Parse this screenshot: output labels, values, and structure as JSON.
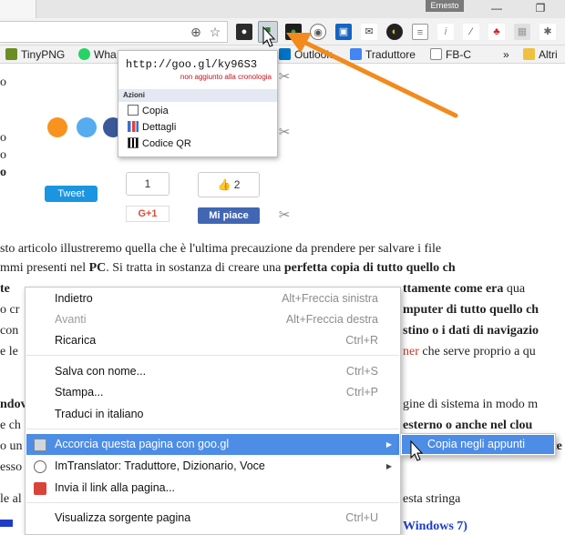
{
  "window": {
    "user_badge": "Ernesto",
    "minimize_glyph": "—",
    "restore_glyph": "❐"
  },
  "toolbar": {
    "zoom_icon": "⊕",
    "star_icon": "☆",
    "extensions": [
      "ghostery-icon",
      "googl-shortener-icon",
      "green-ext-icon",
      "imtranslator-icon",
      "screenshot-icon",
      "mail-icon",
      "colorpicker-icon",
      "notes-icon",
      "info-icon",
      "eyedropper-icon",
      "user-block-icon",
      "image-icon",
      "puzzle-icon"
    ]
  },
  "bookmarks": {
    "items": [
      {
        "label": "TinyPNG"
      },
      {
        "label": "Wha"
      },
      {
        "label": "Outlook"
      },
      {
        "label": "Traduttore"
      },
      {
        "label": "FB-C"
      },
      {
        "label": "Altri"
      }
    ],
    "overflow": "»"
  },
  "googl_popup": {
    "url": "http://goo.gl/ky96S3",
    "note": "non aggiunto alla cronologia",
    "section": "Azioni",
    "actions": [
      {
        "label": "Copia"
      },
      {
        "label": "Dettagli"
      },
      {
        "label": "Codice QR"
      }
    ]
  },
  "social": {
    "tweet_label": "Tweet",
    "gplus_count": "1",
    "gplus_label": "G+1",
    "like_count": "2",
    "like_label": "Mi piace"
  },
  "article": {
    "line1_a": "sto articolo illustreremo quella che è l'ultima precauzione da prendere per salvare i file",
    "line2_a": "mmi presenti nel ",
    "line2_b": "PC",
    "line2_c": ". Si tratta in sostanza di creare una ",
    "line2_d": "perfetta copia di tutto quello ch",
    "line3_a": "te",
    "line3_b": "ttamente come era",
    "line3_c": " qua",
    "line4_a": "o cr",
    "line4_b": "mputer di tutto quello ch",
    "line5_a": "con",
    "line5_b": "stino o i dati di navigazio",
    "line6_a": "e le",
    "line6_b": "ner",
    "line6_c": " che serve proprio a qu",
    "line7_a": "ndov",
    "line7_b": "gine di sistema in modo m",
    "line8_a": "e ch",
    "line8_b": "esterno o anche nel clou",
    "line9_a": "o un",
    "line9_b": "te",
    "line10_a": "esso",
    "line11_a": "le al",
    "line11_b": "esta stringa",
    "line12_b": "Windows 7)"
  },
  "context_menu": {
    "items": [
      {
        "label": "Indietro",
        "shortcut": "Alt+Freccia sinistra"
      },
      {
        "label": "Avanti",
        "shortcut": "Alt+Freccia destra"
      },
      {
        "label": "Ricarica",
        "shortcut": "Ctrl+R"
      },
      {
        "label": "Salva con nome...",
        "shortcut": "Ctrl+S"
      },
      {
        "label": "Stampa...",
        "shortcut": "Ctrl+P"
      },
      {
        "label": "Traduci in italiano",
        "shortcut": ""
      },
      {
        "label": "Accorcia questa pagina con goo.gl",
        "shortcut": ""
      },
      {
        "label": "ImTranslator: Traduttore, Dizionario, Voce",
        "shortcut": ""
      },
      {
        "label": "Invia il link alla pagina...",
        "shortcut": ""
      },
      {
        "label": "Visualizza sorgente pagina",
        "shortcut": "Ctrl+U"
      }
    ],
    "arrow_glyph": "▶"
  },
  "submenu": {
    "item": "Copia negli appunti"
  },
  "colors": {
    "highlight": "#4d8de6",
    "annotation_arrow": "#f28a1e",
    "twitter": "#1b95e0",
    "facebook": "#4267b2"
  }
}
